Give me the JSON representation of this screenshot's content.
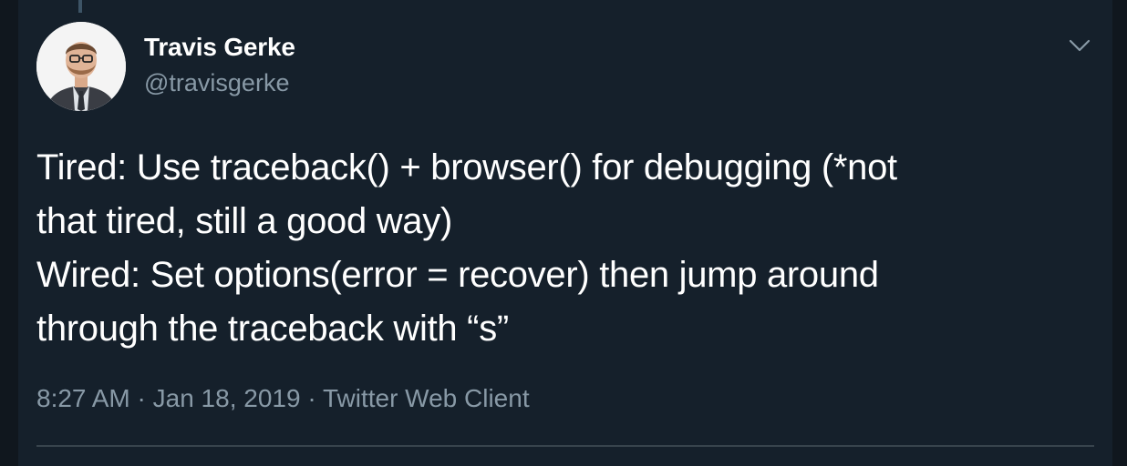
{
  "author": {
    "display_name": "Travis Gerke",
    "handle": "@travisgerke",
    "avatar_icon": "profile-photo"
  },
  "tweet": {
    "lines": [
      "Tired: Use traceback() + browser() for debugging (*not",
      "that tired, still a good way)",
      "Wired: Set options(error = recover) then jump around",
      "through the traceback with “s”"
    ]
  },
  "meta": {
    "time": "8:27 AM",
    "separator": "·",
    "date": "Jan 18, 2019",
    "client": "Twitter Web Client"
  },
  "menu": {
    "icon": "chevron-down-icon"
  },
  "colors": {
    "background": "#15202b",
    "text": "#ffffff",
    "secondary_text": "#8899a6",
    "divider": "#38444d"
  }
}
